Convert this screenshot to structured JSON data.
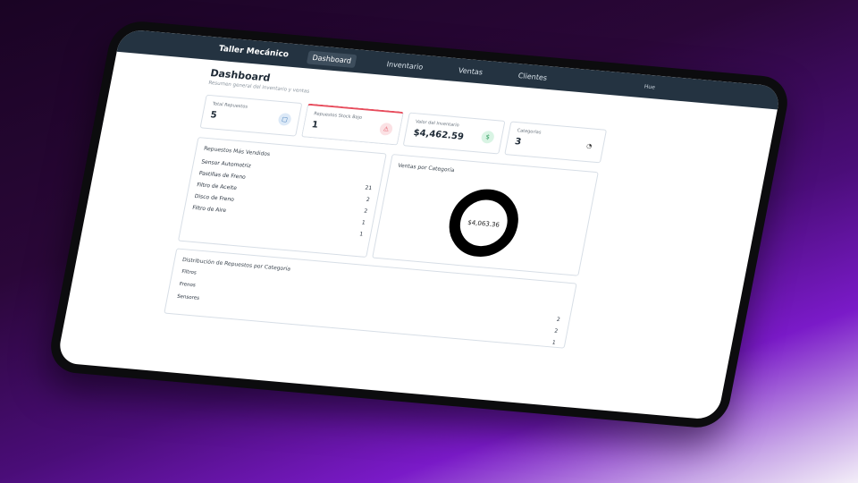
{
  "app": {
    "brand": "Taller Mecánico",
    "user": "Hue"
  },
  "nav": [
    {
      "label": "Dashboard",
      "active": true
    },
    {
      "label": "Inventario",
      "active": false
    },
    {
      "label": "Ventas",
      "active": false
    },
    {
      "label": "Clientes",
      "active": false
    }
  ],
  "page": {
    "title": "Dashboard",
    "subtitle": "Resumen general del inventario y ventas"
  },
  "stats": [
    {
      "label": "Total Repuestos",
      "value": "5",
      "icon": "box-icon"
    },
    {
      "label": "Repuestos Stock Bajo",
      "value": "1",
      "icon": "warning-icon"
    },
    {
      "label": "Valor del Inventario",
      "value": "$4,462.59",
      "icon": "dollar-icon"
    },
    {
      "label": "Categorías",
      "value": "3",
      "icon": "pie-icon"
    }
  ],
  "top_parts": {
    "title": "Repuestos Más Vendidos",
    "rows": [
      {
        "name": "Sensor Automotriz",
        "value": ""
      },
      {
        "name": "Pastillas de Freno",
        "value": "21"
      },
      {
        "name": "Filtro de Aceite",
        "value": "2"
      },
      {
        "name": "Disco de Freno",
        "value": "2"
      },
      {
        "name": "Filtro de Aire",
        "value": "1"
      },
      {
        "name": "",
        "value": "1"
      }
    ]
  },
  "sales_by_category": {
    "title": "Ventas por Categoría",
    "center_label": "$4,063.36"
  },
  "distribution": {
    "title": "Distribución de Repuestos por Categoría",
    "rows": [
      "Filtros",
      "Frenos",
      "Sensores"
    ],
    "values": [
      "2",
      "2",
      "1"
    ]
  }
}
